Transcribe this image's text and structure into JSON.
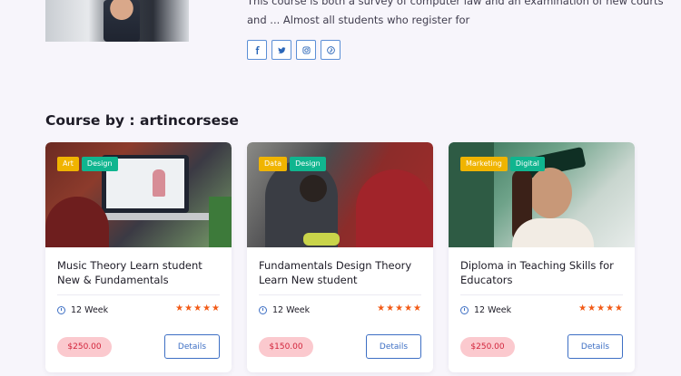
{
  "instructor": {
    "bio": "This course is both a survey of computer law and an examination of new courts and ... Almost all students who register for"
  },
  "socials": [
    {
      "icon": "facebook-icon",
      "glyph": "f"
    },
    {
      "icon": "twitter-icon",
      "glyph": "t"
    },
    {
      "icon": "instagram-icon",
      "glyph": "◎"
    },
    {
      "icon": "pinterest-icon",
      "glyph": "℗"
    }
  ],
  "section": {
    "title": "Course by : artincorsese"
  },
  "courses": [
    {
      "tags": [
        "Art",
        "Design"
      ],
      "title": "Music Theory Learn student New & Fundamentals",
      "duration": "12 Week",
      "rating": 5,
      "price": "$250.00",
      "button": "Details"
    },
    {
      "tags": [
        "Data",
        "Design"
      ],
      "title": "Fundamentals Design Theory Learn New student",
      "duration": "12 Week",
      "rating": 5,
      "price": "$150.00",
      "button": "Details"
    },
    {
      "tags": [
        "Marketing",
        "Digital"
      ],
      "title": "Diploma in Teaching Skills for Educators",
      "duration": "12 Week",
      "rating": 5,
      "price": "$250.00",
      "button": "Details"
    }
  ],
  "colors": {
    "accent": "#3d6fc4",
    "tag_yellow": "#f0b400",
    "tag_teal": "#10b58f",
    "star": "#f25a16",
    "price_bg": "#fbc9ce",
    "price_text": "#d2243b"
  }
}
